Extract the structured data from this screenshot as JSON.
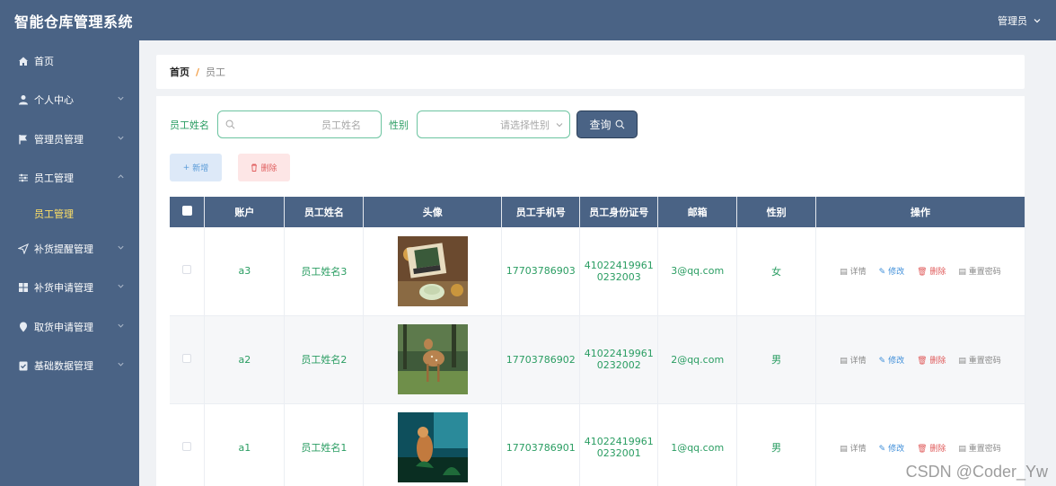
{
  "app": {
    "title": "智能仓库管理系统",
    "user": "管理员"
  },
  "sidebar": {
    "items": [
      {
        "label": "首页",
        "icon": "home-icon",
        "chevron": ""
      },
      {
        "label": "个人中心",
        "icon": "user-icon",
        "chevron": "down"
      },
      {
        "label": "管理员管理",
        "icon": "flag-icon",
        "chevron": "down"
      },
      {
        "label": "员工管理",
        "icon": "sliders-icon",
        "chevron": "up"
      },
      {
        "label": "补货提醒管理",
        "icon": "send-icon",
        "chevron": "down"
      },
      {
        "label": "补货申请管理",
        "icon": "grid-icon",
        "chevron": "down"
      },
      {
        "label": "取货申请管理",
        "icon": "location-icon",
        "chevron": "down"
      },
      {
        "label": "基础数据管理",
        "icon": "clipboard-icon",
        "chevron": "down"
      }
    ],
    "active_sub": "员工管理"
  },
  "breadcrumb": {
    "home": "首页",
    "separator": "/",
    "current": "员工"
  },
  "search": {
    "name_label": "员工姓名",
    "name_placeholder": "员工姓名",
    "gender_label": "性别",
    "gender_placeholder": "请选择性别",
    "query_label": "查询"
  },
  "actions": {
    "add": "新增",
    "delete": "删除"
  },
  "table": {
    "headers": [
      "账户",
      "员工姓名",
      "头像",
      "员工手机号",
      "员工身份证号",
      "邮箱",
      "性别",
      "操作"
    ],
    "rows": [
      {
        "account": "a3",
        "name": "员工姓名3",
        "phone": "17703786903",
        "id_line1": "41022419961",
        "id_line2": "0232003",
        "email": "3@qq.com",
        "gender": "女"
      },
      {
        "account": "a2",
        "name": "员工姓名2",
        "phone": "17703786902",
        "id_line1": "41022419961",
        "id_line2": "0232002",
        "email": "2@qq.com",
        "gender": "男"
      },
      {
        "account": "a1",
        "name": "员工姓名1",
        "phone": "17703786901",
        "id_line1": "41022419961",
        "id_line2": "0232001",
        "email": "1@qq.com",
        "gender": "男"
      }
    ],
    "ops": {
      "detail": "详情",
      "edit": "修改",
      "delete": "删除",
      "reset": "重置密码"
    }
  },
  "watermark": "CSDN @Coder_Yw",
  "colors": {
    "primary": "#4a6385",
    "accent_green": "#2a9d62",
    "active_menu": "#ffe066",
    "danger": "#e05c5c",
    "info": "#3e8ed9"
  }
}
